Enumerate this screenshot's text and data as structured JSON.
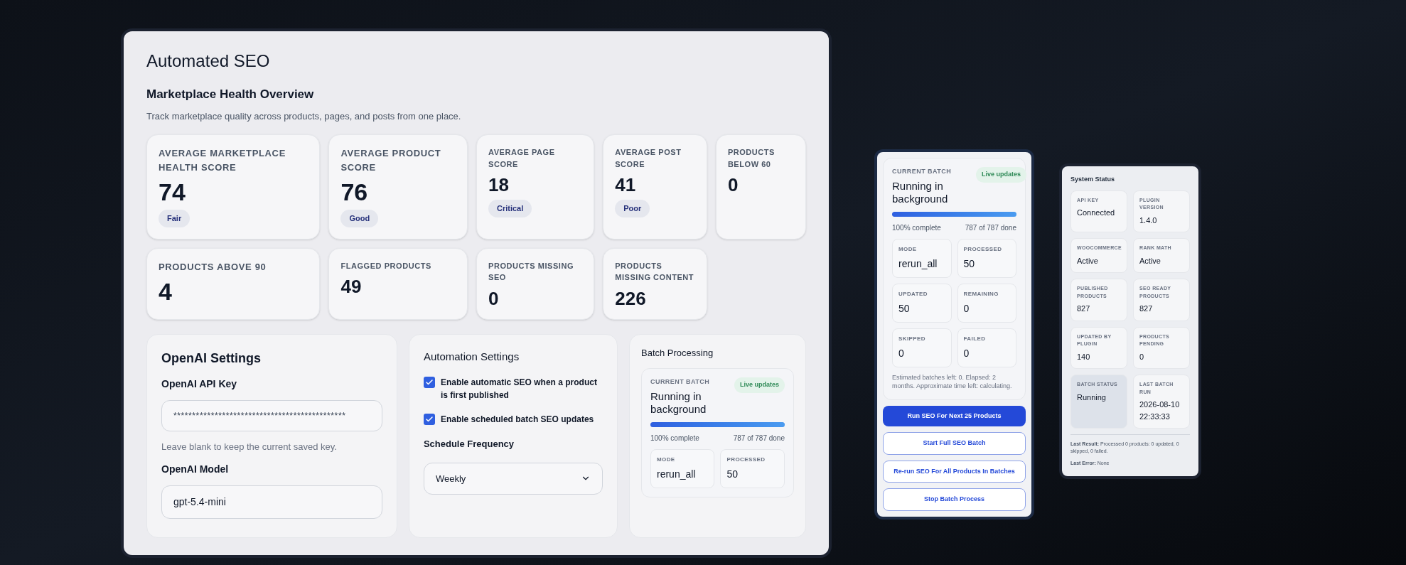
{
  "main_panel": {
    "title": "Automated SEO",
    "section_title": "Marketplace Health Overview",
    "description": "Track marketplace quality across products, pages, and posts from one place.",
    "stats": [
      {
        "label": "AVERAGE MARKETPLACE HEALTH SCORE",
        "value": "74",
        "badge": "Fair"
      },
      {
        "label": "AVERAGE PRODUCT SCORE",
        "value": "76",
        "badge": "Good"
      },
      {
        "label": "AVERAGE PAGE SCORE",
        "value": "18",
        "badge": "Critical"
      },
      {
        "label": "AVERAGE POST SCORE",
        "value": "41",
        "badge": "Poor"
      },
      {
        "label": "PRODUCTS BELOW 60",
        "value": "0"
      },
      {
        "label": "PRODUCTS ABOVE 90",
        "value": "4"
      },
      {
        "label": "FLAGGED PRODUCTS",
        "value": "49"
      },
      {
        "label": "PRODUCTS MISSING SEO",
        "value": "0"
      },
      {
        "label": "PRODUCTS MISSING CONTENT",
        "value": "226"
      }
    ],
    "openai_settings": {
      "title": "OpenAI Settings",
      "api_key": {
        "label": "OpenAI API Key",
        "value": "**********************************************"
      },
      "hint": "Leave blank to keep the current saved key.",
      "model": {
        "label": "OpenAI Model",
        "value": "gpt-5.4-mini"
      }
    },
    "automation_settings": {
      "title": "Automation Settings",
      "options": [
        {
          "label": "Enable automatic SEO when a product is first published",
          "checked": true
        },
        {
          "label": "Enable scheduled batch SEO updates",
          "checked": true
        }
      ],
      "frequency": {
        "label": "Schedule Frequency",
        "value": "Weekly"
      }
    },
    "batch_processing": {
      "title": "Batch Processing",
      "batch": {
        "label": "CURRENT BATCH",
        "status": "Running in background",
        "badge": "Live updates",
        "level": 1,
        "percent_text": "100% complete",
        "count_text": "787 of 787 done",
        "metrics": [
          {
            "label": "MODE",
            "value": "rerun_all"
          },
          {
            "label": "PROCESSED",
            "value": "50"
          }
        ]
      }
    }
  },
  "batch_panel": {
    "batch": {
      "label": "CURRENT BATCH",
      "status": "Running in background",
      "badge": "Live updates",
      "level": 1,
      "percent_text": "100% complete",
      "count_text": "787 of 787 done",
      "metrics": [
        {
          "label": "MODE",
          "value": "rerun_all"
        },
        {
          "label": "PROCESSED",
          "value": "50"
        },
        {
          "label": "UPDATED",
          "value": "50"
        },
        {
          "label": "REMAINING",
          "value": "0"
        },
        {
          "label": "SKIPPED",
          "value": "0"
        },
        {
          "label": "FAILED",
          "value": "0"
        }
      ],
      "note": "Estimated batches left: 0. Elapsed: 2 months. Approximate time left: calculating."
    },
    "buttons": [
      {
        "label": "Run SEO For Next 25 Products",
        "kind": "primary"
      },
      {
        "label": "Start Full SEO Batch",
        "kind": "outline"
      },
      {
        "label": "Re-run SEO For All Products In Batches",
        "kind": "outline"
      },
      {
        "label": "Stop Batch Process",
        "kind": "outline"
      }
    ]
  },
  "system_status": {
    "title": "System Status",
    "items": [
      {
        "label": "API KEY",
        "value": "Connected",
        "highlighted": false
      },
      {
        "label": "PLUGIN VERSION",
        "value": "1.4.0",
        "highlighted": false
      },
      {
        "label": "WOOCOMMERCE",
        "value": "Active",
        "highlighted": false
      },
      {
        "label": "RANK MATH",
        "value": "Active",
        "highlighted": false
      },
      {
        "label": "PUBLISHED PRODUCTS",
        "value": "827",
        "highlighted": false
      },
      {
        "label": "SEO READY PRODUCTS",
        "value": "827",
        "highlighted": false
      },
      {
        "label": "UPDATED BY PLUGIN",
        "value": "140",
        "highlighted": false
      },
      {
        "label": "PRODUCTS PENDING",
        "value": "0",
        "highlighted": false
      },
      {
        "label": "BATCH STATUS",
        "value": "Running",
        "highlighted": true
      },
      {
        "label": "LAST BATCH RUN",
        "value": "2026-08-10 22:33:33",
        "highlighted": false
      }
    ],
    "last_result": "**Last Result:** Processed 0 products: 0 updated, 0 skipped, 0 failed.",
    "last_error": "**Last Error:** None"
  }
}
